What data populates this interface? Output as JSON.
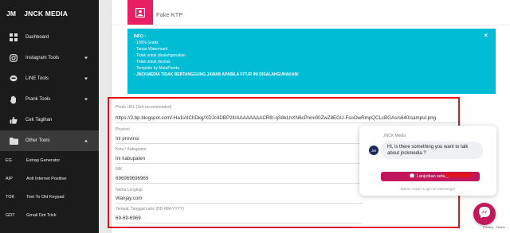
{
  "brand": {
    "abbr": "JM",
    "name": "JNCK MEDIA"
  },
  "nav": [
    {
      "label": "Dashboard",
      "icon": "dashboard-icon",
      "caret": ""
    },
    {
      "label": "Instagram Tools",
      "icon": "instagram-icon",
      "caret": "down"
    },
    {
      "label": "LINE Tools",
      "icon": "line-icon",
      "caret": "down"
    },
    {
      "label": "Prank Tools",
      "icon": "hand-icon",
      "caret": "down"
    },
    {
      "label": "Cek Tagihan",
      "icon": "thumbs-up-icon",
      "caret": ""
    },
    {
      "label": "Other Tools",
      "icon": "folder-icon",
      "caret": "up"
    }
  ],
  "subnav": [
    {
      "abbr": "EG",
      "label": "Extrap Generator"
    },
    {
      "abbr": "AIP",
      "label": "Anti Internet Positive"
    },
    {
      "abbr": "TOK",
      "label": "Text To Old Keypad"
    },
    {
      "abbr": "GDT",
      "label": "Gmail Dot Trick"
    }
  ],
  "card": {
    "title": "Fake KTP"
  },
  "info": {
    "close": "×",
    "title": "INFO :",
    "lines": [
      "- 100% Gratis",
      "- Tanpa Watermark",
      "- Tidak untuk disalahgunakan",
      "- Tidak untuk dicetak",
      "- Template by MataPanda"
    ],
    "warning": "- JNCKMEDIA TIDAK BERTANGGUNG JAWAB APABILA FITUR INI DISALAHGUNAKAN!"
  },
  "form": {
    "photo_label": "Photo URL (3x4 recommended)",
    "photo_value": "https://2.bp.blogspot.com/-Ha1lAtChDkg/XDJc4DBP2lI/AAAAAAAACR8/-qS8kLhXN6cPnmi00ZwZ8EGU-FsoOwRmpQCLcBGAs/s640/sampul.png",
    "provinsi_label": "Provinsi",
    "provinsi_value": "Ini provinsi",
    "kota_label": "Kota / Kabupaten",
    "kota_value": "Ini kabupaten",
    "nik_label": "NIK",
    "nik_value": "696969696969",
    "nama_label": "Nama Lengkap",
    "nama_value": "Wanjay.com",
    "ttl_label": "Tempat, Tanggal Lahir (DD-MM-YYYY)",
    "ttl_value": "69-69-6969"
  },
  "chat": {
    "from": "JNCK Media",
    "avatar": "JM",
    "message": "Hi, is there something you want to talk about jnckmedia ?",
    "cta": "Lanjutkan sebaga",
    "footer": "Bukan Anda? Login ke Messenger"
  },
  "recaptcha": "Privacy - Terms",
  "colors": {
    "accent": "#e91e63",
    "info": "#00bcd4",
    "sidebar": "#1b1b1b",
    "highlight": "#e0141b",
    "messenger": "#c2185b"
  }
}
